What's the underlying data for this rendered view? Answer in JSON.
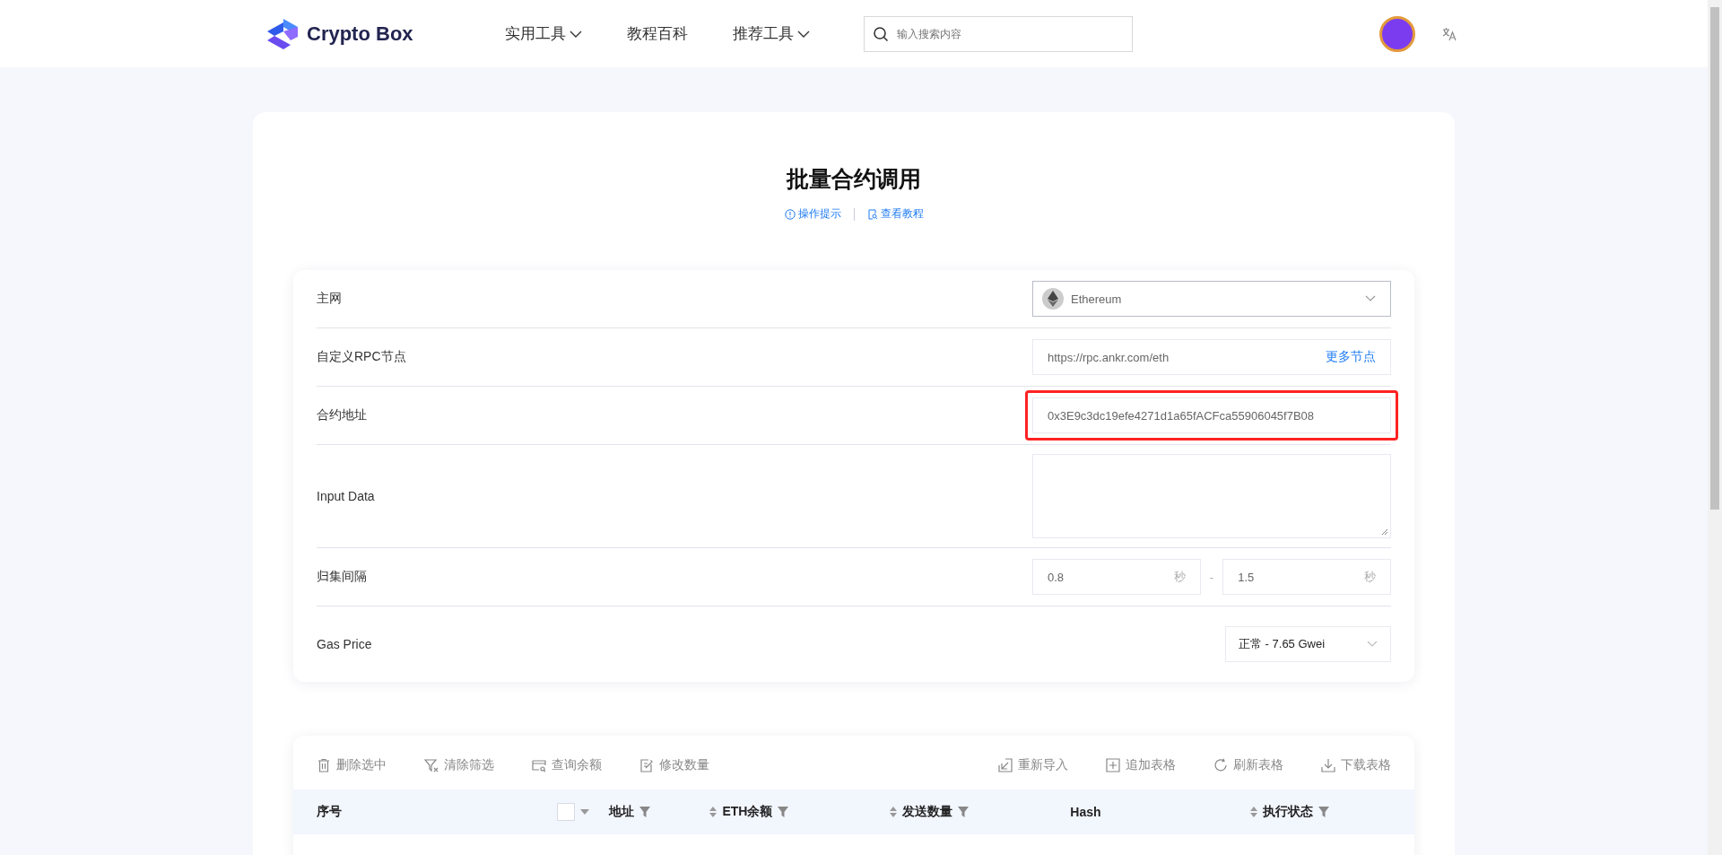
{
  "header": {
    "logo": "Crypto Box",
    "nav": [
      {
        "label": "实用工具",
        "dropdown": true
      },
      {
        "label": "教程百科",
        "dropdown": false
      },
      {
        "label": "推荐工具",
        "dropdown": true
      }
    ],
    "search": {
      "placeholder": "输入搜索内容"
    }
  },
  "page": {
    "title": "批量合约调用",
    "links": [
      {
        "label": "操作提示"
      },
      {
        "label": "查看教程"
      }
    ]
  },
  "form": [
    {
      "kind": "select",
      "label": "主网",
      "value": "Ethereum"
    },
    {
      "kind": "link_input",
      "label": "自定义RPC节点",
      "value": "https://rpc.ankr.com/eth",
      "link": "更多节点"
    },
    {
      "kind": "input",
      "label": "合约地址",
      "value": "0x3E9c3dc19efe4271d1a65fACFca55906045f7B08",
      "highlighted": true
    },
    {
      "kind": "textarea",
      "label": "Input Data"
    },
    {
      "kind": "range",
      "label": "归集间隔",
      "from": "0.8",
      "to": "1.5",
      "unit_from": "秒",
      "unit_to": "秒",
      "separator": "-"
    },
    {
      "kind": "small_select",
      "label": "Gas Price",
      "value": "正常 - 7.65 Gwei"
    }
  ],
  "toolbar": {
    "left": [
      {
        "label": "删除选中"
      },
      {
        "label": "清除筛选"
      },
      {
        "label": "查询余额"
      },
      {
        "label": "修改数量"
      }
    ],
    "right": [
      {
        "label": "重新导入"
      },
      {
        "label": "追加表格"
      },
      {
        "label": "刷新表格"
      },
      {
        "label": "下载表格"
      }
    ]
  },
  "table": {
    "columns": [
      {
        "kind": "plain",
        "label": "序号"
      },
      {
        "kind": "select_filter",
        "label": "地址",
        "checked": false
      },
      {
        "kind": "sort_filter",
        "label": "ETH余额"
      },
      {
        "kind": "sort_filter",
        "label": "发送数量"
      },
      {
        "kind": "plain",
        "label": "Hash"
      },
      {
        "kind": "sort_filter",
        "label": "执行状态"
      }
    ]
  }
}
